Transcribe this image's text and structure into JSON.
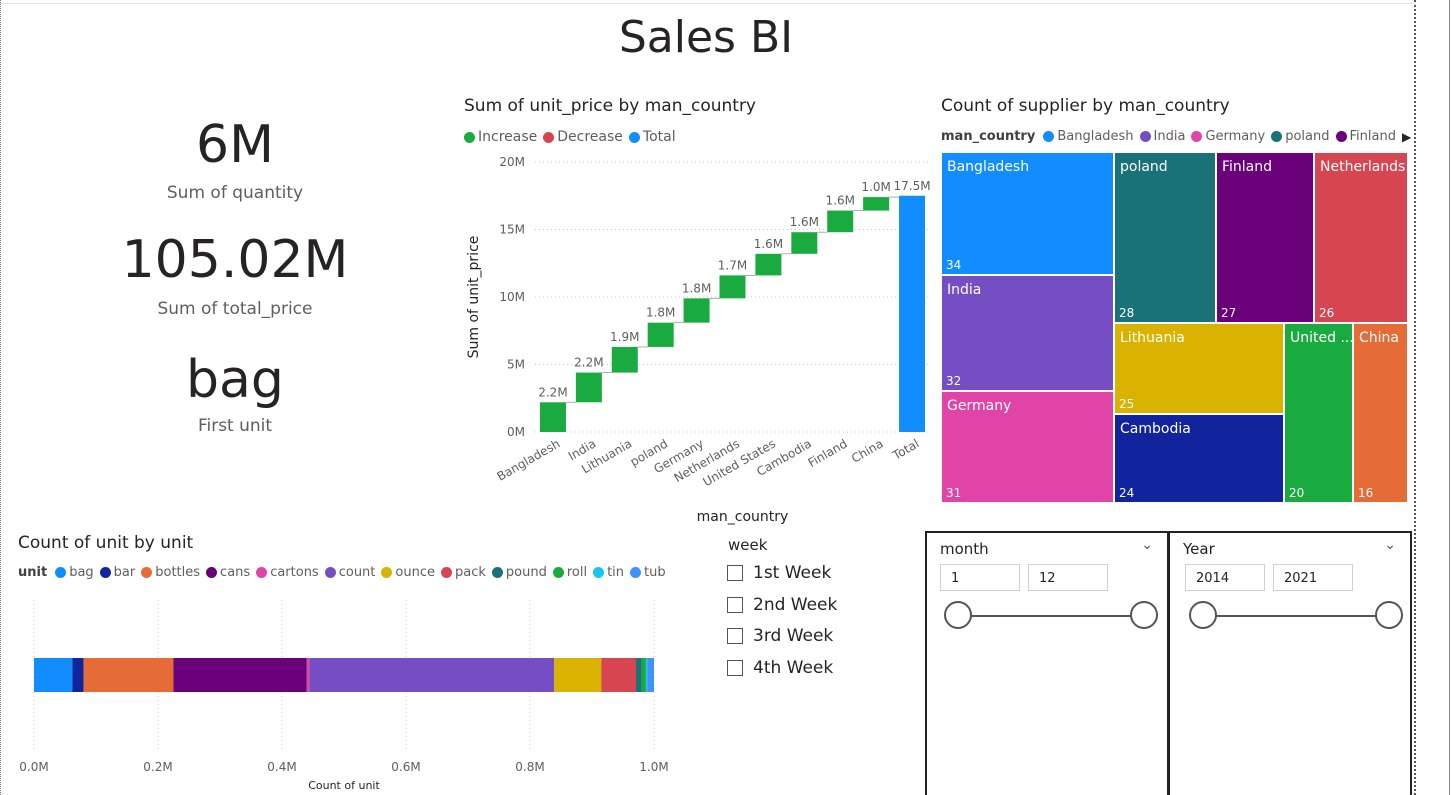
{
  "page": {
    "title": "Sales BI"
  },
  "kpis": [
    {
      "value": "6M",
      "label": "Sum of quantity"
    },
    {
      "value": "105.02M",
      "label": "Sum of total_price"
    },
    {
      "value": "bag",
      "label": "First unit"
    }
  ],
  "waterfall": {
    "title": "Sum of unit_price by man_country",
    "legend": [
      {
        "label": "Increase",
        "color": "#1aab40"
      },
      {
        "label": "Decrease",
        "color": "#d64550"
      },
      {
        "label": "Total",
        "color": "#118dff"
      }
    ],
    "chart_data": {
      "type": "bar",
      "subtype": "waterfall",
      "xlabel": "man_country",
      "ylabel": "Sum of unit_price",
      "ylim": [
        0,
        20
      ],
      "y_ticks": [
        "0M",
        "5M",
        "10M",
        "15M",
        "20M"
      ],
      "y_tick_values": [
        0,
        5,
        10,
        15,
        20
      ],
      "categories": [
        "Bangladesh",
        "India",
        "Lithuania",
        "poland",
        "Germany",
        "Netherlands",
        "United States",
        "Cambodia",
        "Finland",
        "China",
        "Total"
      ],
      "values": [
        2.2,
        2.2,
        1.9,
        1.8,
        1.8,
        1.7,
        1.6,
        1.6,
        1.6,
        1.0,
        17.5
      ],
      "labels": [
        "2.2M",
        "2.2M",
        "1.9M",
        "1.8M",
        "1.8M",
        "1.7M",
        "1.6M",
        "1.6M",
        "1.6M",
        "1.0M",
        "17.5M"
      ],
      "grid": true
    }
  },
  "treemap": {
    "title": "Count of supplier by man_country",
    "legend_title": "man_country",
    "legend": [
      {
        "label": "Bangladesh",
        "color": "#118dff"
      },
      {
        "label": "India",
        "color": "#744ec2"
      },
      {
        "label": "Germany",
        "color": "#e044a7"
      },
      {
        "label": "poland",
        "color": "#197278"
      },
      {
        "label": "Finland",
        "color": "#6b007b"
      }
    ],
    "chart_data": {
      "type": "treemap",
      "items": [
        {
          "name": "Bangladesh",
          "value": 34,
          "color": "#118dff"
        },
        {
          "name": "India",
          "value": 32,
          "color": "#744ec2"
        },
        {
          "name": "Germany",
          "value": 31,
          "color": "#e044a7"
        },
        {
          "name": "poland",
          "value": 28,
          "color": "#197278"
        },
        {
          "name": "Finland",
          "value": 27,
          "color": "#6b007b"
        },
        {
          "name": "Netherlands",
          "value": 26,
          "color": "#d64550"
        },
        {
          "name": "Lithuania",
          "value": 25,
          "color": "#d9b300"
        },
        {
          "name": "Cambodia",
          "value": 24,
          "color": "#12239e"
        },
        {
          "name": "United ...",
          "value": 20,
          "color": "#1aab40"
        },
        {
          "name": "China",
          "value": 16,
          "color": "#e66c37"
        }
      ]
    }
  },
  "stacked": {
    "title": "Count of unit by unit",
    "legend_title": "unit",
    "chart_data": {
      "type": "bar",
      "subtype": "stacked-horizontal",
      "xlabel": "Count of unit",
      "xlim": [
        0,
        1.0
      ],
      "x_ticks": [
        "0.0M",
        "0.2M",
        "0.4M",
        "0.6M",
        "0.8M",
        "1.0M"
      ],
      "x_tick_values": [
        0,
        0.2,
        0.4,
        0.6,
        0.8,
        1.0
      ],
      "series": [
        {
          "name": "bag",
          "value": 0.062,
          "color": "#118dff"
        },
        {
          "name": "bar",
          "value": 0.018,
          "color": "#12239e"
        },
        {
          "name": "bottles",
          "value": 0.145,
          "color": "#e66c37"
        },
        {
          "name": "cans",
          "value": 0.215,
          "color": "#6b007b"
        },
        {
          "name": "cartons",
          "value": 0.004,
          "color": "#e044a7"
        },
        {
          "name": "count",
          "value": 0.395,
          "color": "#744ec2"
        },
        {
          "name": "ounce",
          "value": 0.076,
          "color": "#d9b300"
        },
        {
          "name": "pack",
          "value": 0.056,
          "color": "#d64550"
        },
        {
          "name": "pound",
          "value": 0.009,
          "color": "#197278"
        },
        {
          "name": "roll",
          "value": 0.007,
          "color": "#1aab40"
        },
        {
          "name": "tin",
          "value": 0.002,
          "color": "#15c6f4"
        },
        {
          "name": "tub",
          "value": 0.011,
          "color": "#4092ff"
        }
      ]
    }
  },
  "week_slicer": {
    "title": "week",
    "items": [
      "1st Week",
      "2nd Week",
      "3rd Week",
      "4th Week"
    ]
  },
  "month_slicer": {
    "title": "month",
    "min": "1",
    "max": "12"
  },
  "year_slicer": {
    "title": "Year",
    "min": "2014",
    "max": "2021"
  }
}
